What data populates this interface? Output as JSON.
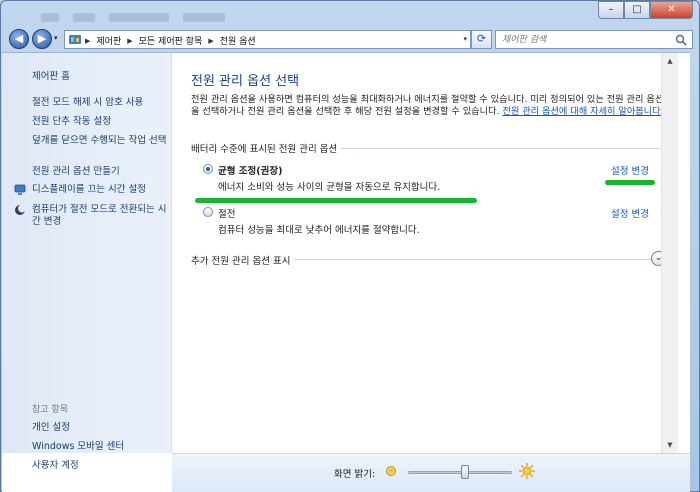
{
  "address": {
    "crumbs": [
      "제어판",
      "모든 제어판 항목",
      "전원 옵션"
    ]
  },
  "search": {
    "placeholder": "제어판 검색"
  },
  "sidebar": {
    "home": "제어판 홈",
    "links": [
      {
        "label": "절전 모드 해제 시 암호 사용",
        "icon": null
      },
      {
        "label": "전원 단추 작동 설정",
        "icon": null
      },
      {
        "label": "덮개를 닫으면 수행되는 작업 선택",
        "icon": null
      },
      {
        "label": "전원 관리 옵션 만들기",
        "icon": null
      },
      {
        "label": "디스플레이를 끄는 시간 설정",
        "icon": "display-icon"
      },
      {
        "label": "컴퓨터가 절전 모드로 전환되는 시간 변경",
        "icon": "sleep-moon-icon"
      }
    ],
    "see_also_title": "참고 항목",
    "see_also": [
      "개인 설정",
      "Windows 모바일 센터",
      "사용자 계정"
    ]
  },
  "main": {
    "title": "전원 관리 옵션 선택",
    "intro": "전원 관리 옵션을 사용하면 컴퓨터의 성능을 최대화하거나 에너지를 절약할 수 있습니다. 미리 정의되어 있는 전원 관리 옵션을 선택하거나 전원 관리 옵션을 선택한 후 해당 전원 설정을 변경할 수 있습니다.",
    "intro_link": "전원 관리 옵션에 대해 자세히 알아봅니다.",
    "section_label": "배터리 수준에 표시된 전원 관리 옵션",
    "plans": [
      {
        "name": "균형 조정(권장)",
        "desc": "에너지 소비와 성능 사이의 균형을 자동으로 유지합니다.",
        "change": "설정 변경",
        "selected": true
      },
      {
        "name": "절전",
        "desc": "컴퓨터 성능을 최대로 낮추어 에너지를 절약합니다.",
        "change": "설정 변경",
        "selected": false
      }
    ],
    "more_label": "추가 전원 관리 옵션 표시"
  },
  "bottom": {
    "brightness_label": "화면 밝기:",
    "brightness_level": 0.55
  },
  "colors": {
    "link": "#1a55b3",
    "title": "#1e3e8c",
    "highlight": "#18b32f"
  }
}
